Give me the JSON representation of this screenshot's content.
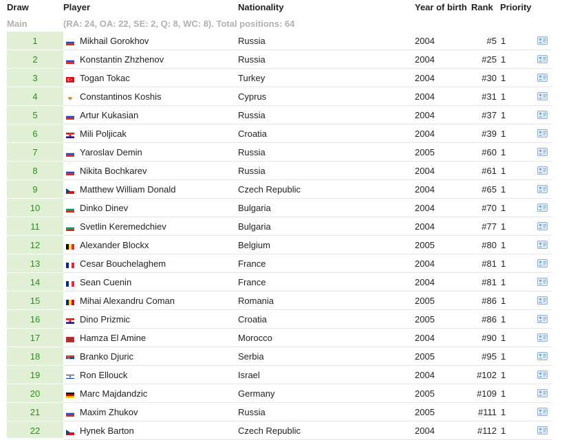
{
  "columns": {
    "draw": "Draw",
    "player": "Player",
    "nationality": "Nationality",
    "year_of_birth": "Year of birth",
    "rank": "Rank",
    "priority": "Priority"
  },
  "section": {
    "name": "Main",
    "summary": "(RA: 24, OA: 22, SE: 2, Q: 8, WC: 8). Total positions: 64"
  },
  "colors": {
    "draw_bg": "#dff0d4",
    "draw_text": "#2e8b1e",
    "subheader_text": "#b0b0b0"
  },
  "rows": [
    {
      "draw": "1",
      "player": "Mikhail Gorokhov",
      "nationality": "Russia",
      "yob": "2004",
      "rank": "#5",
      "priority": "1",
      "flag": "russia"
    },
    {
      "draw": "2",
      "player": "Konstantin Zhzhenov",
      "nationality": "Russia",
      "yob": "2004",
      "rank": "#25",
      "priority": "1",
      "flag": "russia"
    },
    {
      "draw": "3",
      "player": "Togan Tokac",
      "nationality": "Turkey",
      "yob": "2004",
      "rank": "#30",
      "priority": "1",
      "flag": "turkey"
    },
    {
      "draw": "4",
      "player": "Constantinos Koshis",
      "nationality": "Cyprus",
      "yob": "2004",
      "rank": "#31",
      "priority": "1",
      "flag": "cyprus"
    },
    {
      "draw": "5",
      "player": "Artur Kukasian",
      "nationality": "Russia",
      "yob": "2004",
      "rank": "#37",
      "priority": "1",
      "flag": "russia"
    },
    {
      "draw": "6",
      "player": "Mili Poljicak",
      "nationality": "Croatia",
      "yob": "2004",
      "rank": "#39",
      "priority": "1",
      "flag": "croatia"
    },
    {
      "draw": "7",
      "player": "Yaroslav Demin",
      "nationality": "Russia",
      "yob": "2005",
      "rank": "#60",
      "priority": "1",
      "flag": "russia"
    },
    {
      "draw": "8",
      "player": "Nikita Bochkarev",
      "nationality": "Russia",
      "yob": "2004",
      "rank": "#61",
      "priority": "1",
      "flag": "russia"
    },
    {
      "draw": "9",
      "player": "Matthew William Donald",
      "nationality": "Czech Republic",
      "yob": "2004",
      "rank": "#65",
      "priority": "1",
      "flag": "czech"
    },
    {
      "draw": "10",
      "player": "Dinko Dinev",
      "nationality": "Bulgaria",
      "yob": "2004",
      "rank": "#70",
      "priority": "1",
      "flag": "bulgaria"
    },
    {
      "draw": "11",
      "player": "Svetlin Keremedchiev",
      "nationality": "Bulgaria",
      "yob": "2004",
      "rank": "#77",
      "priority": "1",
      "flag": "bulgaria"
    },
    {
      "draw": "12",
      "player": "Alexander Blockx",
      "nationality": "Belgium",
      "yob": "2005",
      "rank": "#80",
      "priority": "1",
      "flag": "belgium"
    },
    {
      "draw": "13",
      "player": "Cesar Bouchelaghem",
      "nationality": "France",
      "yob": "2004",
      "rank": "#81",
      "priority": "1",
      "flag": "france"
    },
    {
      "draw": "14",
      "player": "Sean Cuenin",
      "nationality": "France",
      "yob": "2004",
      "rank": "#81",
      "priority": "1",
      "flag": "france"
    },
    {
      "draw": "15",
      "player": "Mihai Alexandru Coman",
      "nationality": "Romania",
      "yob": "2005",
      "rank": "#86",
      "priority": "1",
      "flag": "romania"
    },
    {
      "draw": "16",
      "player": "Dino Prizmic",
      "nationality": "Croatia",
      "yob": "2005",
      "rank": "#86",
      "priority": "1",
      "flag": "croatia"
    },
    {
      "draw": "17",
      "player": "Hamza El Amine",
      "nationality": "Morocco",
      "yob": "2004",
      "rank": "#90",
      "priority": "1",
      "flag": "morocco"
    },
    {
      "draw": "18",
      "player": "Branko Djuric",
      "nationality": "Serbia",
      "yob": "2005",
      "rank": "#95",
      "priority": "1",
      "flag": "serbia"
    },
    {
      "draw": "19",
      "player": "Ron Ellouck",
      "nationality": "Israel",
      "yob": "2004",
      "rank": "#102",
      "priority": "1",
      "flag": "israel"
    },
    {
      "draw": "20",
      "player": "Marc Majdandzic",
      "nationality": "Germany",
      "yob": "2005",
      "rank": "#109",
      "priority": "1",
      "flag": "germany"
    },
    {
      "draw": "21",
      "player": "Maxim Zhukov",
      "nationality": "Russia",
      "yob": "2005",
      "rank": "#111",
      "priority": "1",
      "flag": "russia"
    },
    {
      "draw": "22",
      "player": "Hynek Barton",
      "nationality": "Czech Republic",
      "yob": "2004",
      "rank": "#112",
      "priority": "1",
      "flag": "czech"
    }
  ]
}
